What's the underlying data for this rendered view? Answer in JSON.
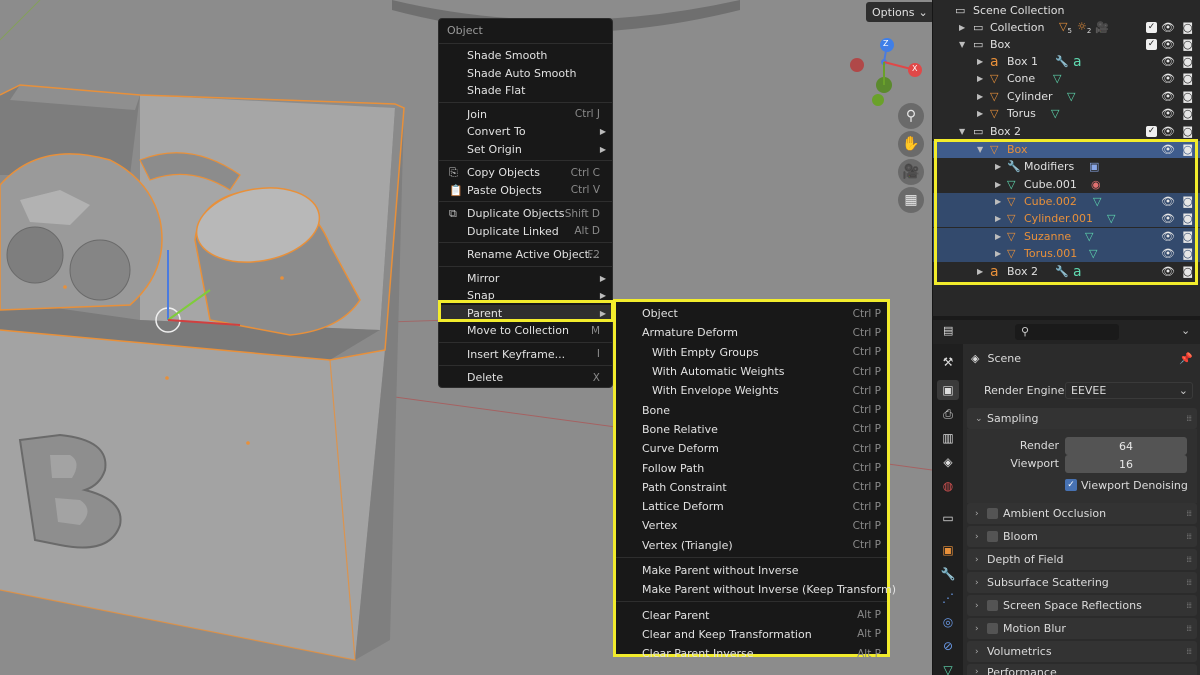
{
  "viewport": {
    "options_label": "Options",
    "gizmo_labels": {
      "z": "Z",
      "x": "X"
    }
  },
  "context_menu": {
    "title": "Object",
    "items": [
      {
        "label": "Shade Smooth",
        "shortcut": ""
      },
      {
        "label": "Shade Auto Smooth",
        "shortcut": ""
      },
      {
        "label": "Shade Flat",
        "shortcut": ""
      },
      {
        "label": "Join",
        "shortcut": "Ctrl J"
      },
      {
        "label": "Convert To",
        "shortcut": ""
      },
      {
        "label": "Set Origin",
        "shortcut": ""
      },
      {
        "label": "Copy Objects",
        "shortcut": "Ctrl C"
      },
      {
        "label": "Paste Objects",
        "shortcut": "Ctrl V"
      },
      {
        "label": "Duplicate Objects",
        "shortcut": "Shift D"
      },
      {
        "label": "Duplicate Linked",
        "shortcut": "Alt D"
      },
      {
        "label": "Rename Active Object...",
        "shortcut": "F2"
      },
      {
        "label": "Mirror",
        "shortcut": ""
      },
      {
        "label": "Snap",
        "shortcut": ""
      },
      {
        "label": "Parent",
        "shortcut": ""
      },
      {
        "label": "Move to Collection",
        "shortcut": "M"
      },
      {
        "label": "Insert Keyframe...",
        "shortcut": "I"
      },
      {
        "label": "Delete",
        "shortcut": "X"
      }
    ]
  },
  "parent_menu": {
    "items": [
      {
        "label": "Object",
        "shortcut": "Ctrl P"
      },
      {
        "label": "Armature Deform",
        "shortcut": "Ctrl P"
      },
      {
        "label": "With Empty Groups",
        "shortcut": "Ctrl P"
      },
      {
        "label": "With Automatic Weights",
        "shortcut": "Ctrl P"
      },
      {
        "label": "With Envelope Weights",
        "shortcut": "Ctrl P"
      },
      {
        "label": "Bone",
        "shortcut": "Ctrl P"
      },
      {
        "label": "Bone Relative",
        "shortcut": "Ctrl P"
      },
      {
        "label": "Curve Deform",
        "shortcut": "Ctrl P"
      },
      {
        "label": "Follow Path",
        "shortcut": "Ctrl P"
      },
      {
        "label": "Path Constraint",
        "shortcut": "Ctrl P"
      },
      {
        "label": "Lattice Deform",
        "shortcut": "Ctrl P"
      },
      {
        "label": "Vertex",
        "shortcut": "Ctrl P"
      },
      {
        "label": "Vertex (Triangle)",
        "shortcut": "Ctrl P"
      },
      {
        "label": "Make Parent without Inverse",
        "shortcut": ""
      },
      {
        "label": "Make Parent without Inverse (Keep Transform)",
        "shortcut": ""
      },
      {
        "label": "Clear Parent",
        "shortcut": "Alt P"
      },
      {
        "label": "Clear and Keep Transformation",
        "shortcut": "Alt P"
      },
      {
        "label": "Clear Parent Inverse",
        "shortcut": "Alt P"
      }
    ]
  },
  "outliner": {
    "rows": [
      {
        "label": "Scene Collection"
      },
      {
        "label": "Collection",
        "badge1": "5",
        "badge2": "2"
      },
      {
        "label": "Box"
      },
      {
        "label": "Box 1"
      },
      {
        "label": "Cone"
      },
      {
        "label": "Cylinder"
      },
      {
        "label": "Torus"
      },
      {
        "label": "Box 2"
      },
      {
        "label": "Box"
      },
      {
        "label": "Modifiers"
      },
      {
        "label": "Cube.001"
      },
      {
        "label": "Cube.002"
      },
      {
        "label": "Cylinder.001"
      },
      {
        "label": "Suzanne"
      },
      {
        "label": "Torus.001"
      },
      {
        "label": "Box 2"
      }
    ]
  },
  "properties": {
    "scene_label": "Scene",
    "render_engine_label": "Render Engine",
    "render_engine_value": "EEVEE",
    "sampling_label": "Sampling",
    "render_label": "Render",
    "render_value": "64",
    "viewport_label": "Viewport",
    "viewport_value": "16",
    "denoise_label": "Viewport Denoising",
    "panels": [
      "Ambient Occlusion",
      "Bloom",
      "Depth of Field",
      "Subsurface Scattering",
      "Screen Space Reflections",
      "Motion Blur",
      "Volumetrics",
      "Performance"
    ]
  },
  "colors": {
    "highlight": "#f2ec2c",
    "selection": "#334a6d",
    "object_orange": "#e8903a",
    "mesh_green": "#5fd9b0"
  }
}
